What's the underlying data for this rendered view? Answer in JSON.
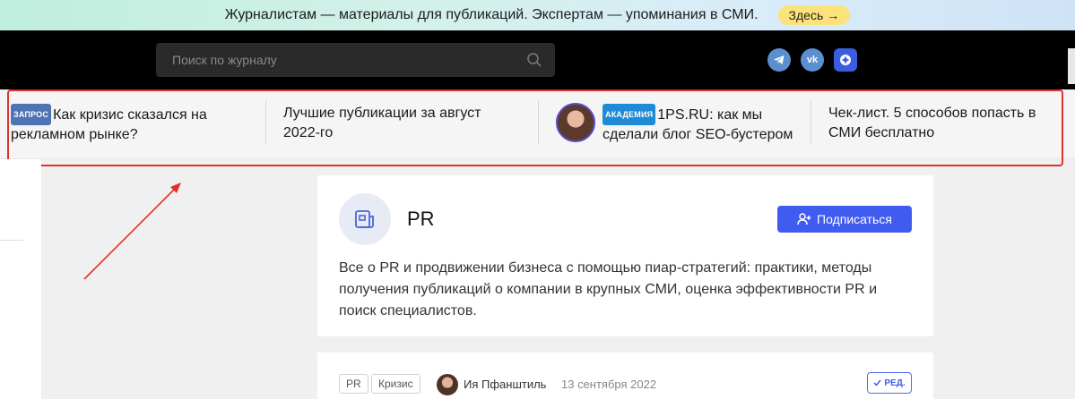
{
  "promo": {
    "text": "Журналистам — материалы для публикаций. Экспертам — упоминания в СМИ.",
    "button_label": "Здесь",
    "button_arrow": "→"
  },
  "header": {
    "search_placeholder": "Поиск по журналу",
    "social": [
      {
        "name": "telegram-icon"
      },
      {
        "name": "vk-icon",
        "label": "vk"
      },
      {
        "name": "zen-icon"
      }
    ]
  },
  "news_strip": {
    "items": [
      {
        "badge": "ЗАПРОС",
        "title": "Как кризис сказался на рекламном рынке?"
      },
      {
        "title": "Лучшие публикации за август 2022-го"
      },
      {
        "badge": "АКАДЕМИЯ",
        "title": "1PS.RU: как мы сделали блог SEO-бустером"
      },
      {
        "title": "Чек-лист. 5 способов попасть в СМИ бесплатно"
      }
    ]
  },
  "topic": {
    "title": "PR",
    "subscribe_label": "Подписаться",
    "description": "Все о PR и продвижении бизнеса с помощью пиар-стратегий: практики, методы получения публикаций о компании в крупных СМИ, оценка эффективности PR и поиск специалистов."
  },
  "post": {
    "tags": [
      "PR",
      "Кризис"
    ],
    "author": "Ия Пфанштиль",
    "date": "13 сентября 2022",
    "edit_badge": "РЕД."
  },
  "colors": {
    "highlight": "#e0322d",
    "accent": "#3f5bf0",
    "promo_button": "#fbe27a"
  }
}
